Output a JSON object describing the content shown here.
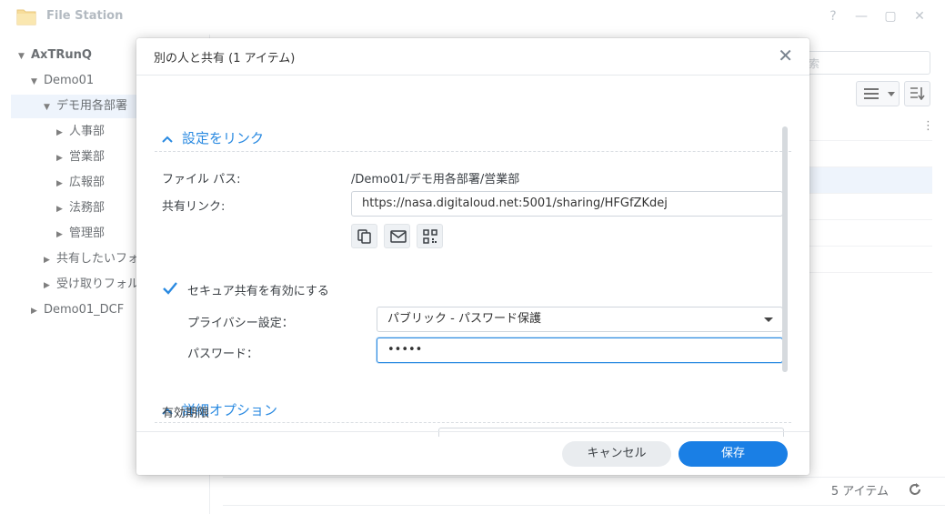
{
  "app": {
    "title": "File Station",
    "window_buttons": {
      "help": "?",
      "minimize": "—",
      "maximize": "▢",
      "close": "✕"
    }
  },
  "sidebar": {
    "items": [
      {
        "label": "AxTRunQ",
        "level": 0,
        "expanded": true,
        "bold": true
      },
      {
        "label": "Demo01",
        "level": 1,
        "expanded": true
      },
      {
        "label": "デモ用各部署",
        "level": 2,
        "expanded": true,
        "selected": true
      },
      {
        "label": "人事部",
        "level": 3,
        "expanded": false
      },
      {
        "label": "営業部",
        "level": 3,
        "expanded": false
      },
      {
        "label": "広報部",
        "level": 3,
        "expanded": false
      },
      {
        "label": "法務部",
        "level": 3,
        "expanded": false
      },
      {
        "label": "管理部",
        "level": 3,
        "expanded": false
      },
      {
        "label": "共有したいフォ",
        "level": 2,
        "expanded": false
      },
      {
        "label": "受け取りフォル",
        "level": 2,
        "expanded": false
      },
      {
        "label": "Demo01_DCF",
        "level": 1,
        "expanded": false
      }
    ]
  },
  "main": {
    "search_placeholder_fragment": "索",
    "status_count": "5 アイテム"
  },
  "dialog": {
    "title": "別の人と共有 (1 アイテム)",
    "close_glyph": "✕",
    "link_section": {
      "heading": "設定をリンク",
      "file_path_label": "ファイル パス:",
      "file_path_value": "/Demo01/デモ用各部署/営業部",
      "share_link_label": "共有リンク:",
      "share_link_value": "https://nasa.digitaloud.net:5001/sharing/HFGfZKdej",
      "action_icons": [
        "copy-icon",
        "mail-icon",
        "qr-code-icon"
      ],
      "secure_share_label": "セキュア共有を有効にする",
      "secure_share_checked": true,
      "privacy_label": "プライバシー設定：",
      "privacy_value": "パブリック - パスワード保護",
      "password_label": "パスワード：",
      "password_value": "•••••"
    },
    "advanced_section": {
      "heading": "詳細オプション",
      "expiry_label": "有効期限"
    },
    "buttons": {
      "cancel": "キャンセル",
      "save": "保存"
    },
    "accent_color": "#2a8ae1",
    "save_color": "#1a7fe5"
  }
}
